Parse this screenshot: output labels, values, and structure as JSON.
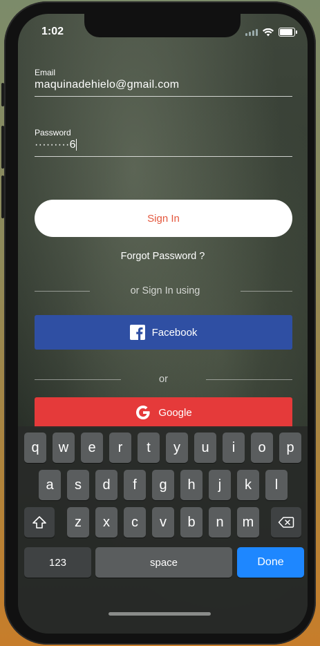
{
  "status_bar": {
    "time": "1:02"
  },
  "email": {
    "label": "Email",
    "value": "maquinadehielo@gmail.com"
  },
  "password": {
    "label": "Password",
    "masked_value": "·········6"
  },
  "sign_in_button": {
    "label": "Sign In"
  },
  "forgot_password": {
    "label": "Forgot Password ?"
  },
  "divider_sign_in_using": {
    "label": "or Sign In using"
  },
  "facebook_button": {
    "label": "Facebook",
    "icon": "facebook-icon"
  },
  "divider_or": {
    "label": "or"
  },
  "google_button": {
    "label": "Google",
    "icon": "google-icon"
  },
  "keyboard": {
    "row1": [
      "q",
      "w",
      "e",
      "r",
      "t",
      "y",
      "u",
      "i",
      "o",
      "p"
    ],
    "row2": [
      "a",
      "s",
      "d",
      "f",
      "g",
      "h",
      "j",
      "k",
      "l"
    ],
    "row3": [
      "z",
      "x",
      "c",
      "v",
      "b",
      "n",
      "m"
    ],
    "shift_icon": "shift-icon",
    "backspace_icon": "backspace-icon",
    "numbers_label": "123",
    "space_label": "space",
    "done_label": "Done"
  },
  "colors": {
    "sign_in_text": "#e4573d",
    "facebook": "#2f4fa3",
    "google": "#e53a3a",
    "done_key": "#1e87ff"
  }
}
